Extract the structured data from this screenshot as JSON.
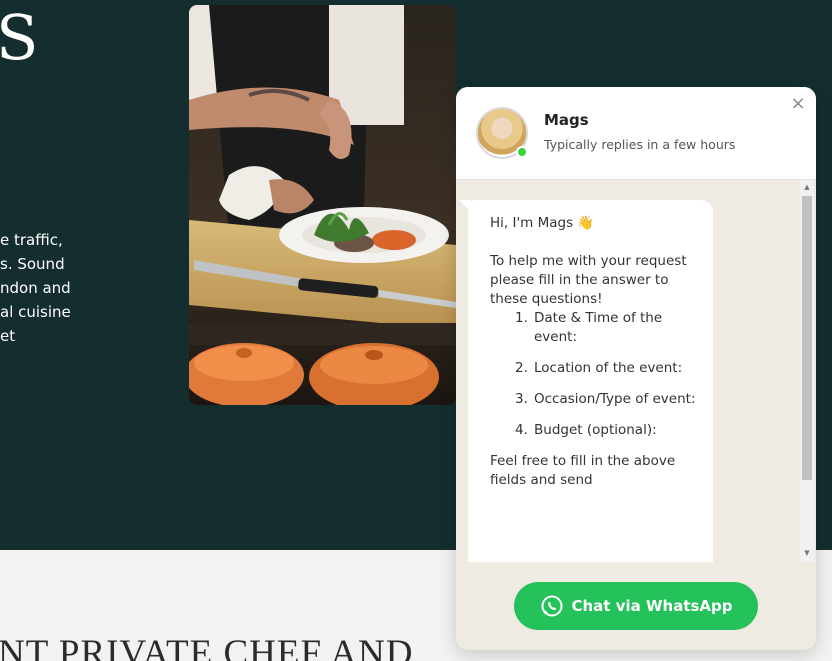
{
  "hero": {
    "big_letter": "S",
    "text_lines": [
      "e traffic,",
      "s. Sound",
      "ndon and",
      "al cuisine",
      "et"
    ]
  },
  "below": {
    "heading": "NT PRIVATE CHEF AND"
  },
  "widget": {
    "agent_name": "Mags",
    "agent_status": "Typically replies in a few hours",
    "close_glyph": "×",
    "greeting": "Hi, I'm Mags 👋",
    "intro": "To help me with your request please fill in the answer to these questions!",
    "questions": [
      {
        "num": "1.",
        "text": "Date & Time of the event:"
      },
      {
        "num": "2.",
        "text": "Location of the event:"
      },
      {
        "num": "3.",
        "text": "Occasion/Type of event:"
      },
      {
        "num": "4.",
        "text": "Budget (optional):"
      }
    ],
    "outro": "Feel free to fill in the above fields and send",
    "cta_label": "Chat via WhatsApp",
    "colors": {
      "cta": "#25c15b",
      "online": "#3ad13a",
      "hero_bg": "#142e2f"
    },
    "icons": {
      "close": "close-icon",
      "cta": "whatsapp-icon"
    }
  }
}
